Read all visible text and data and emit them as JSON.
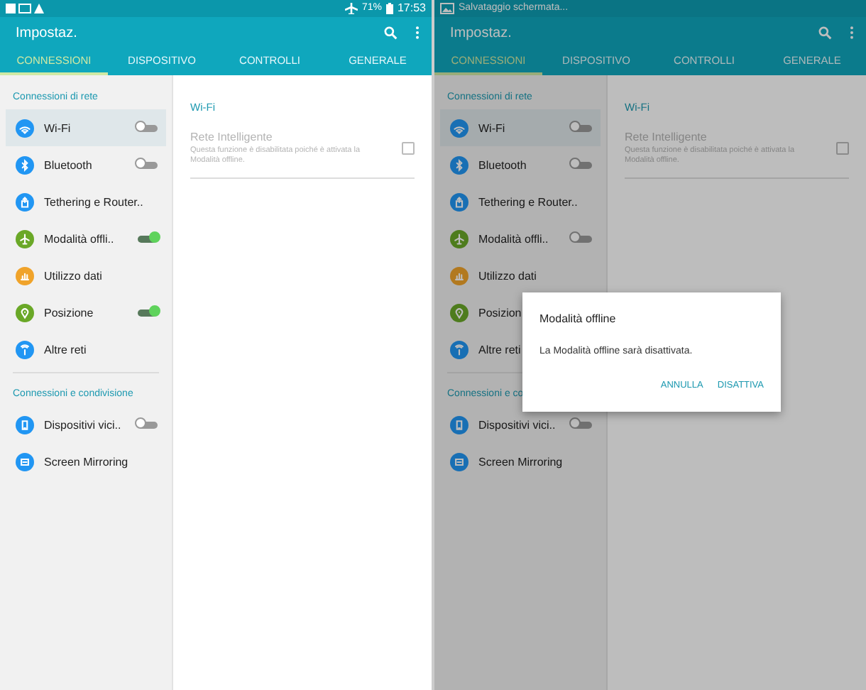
{
  "screens": [
    {
      "status_bar": {
        "battery": "71%",
        "time": "17:53"
      },
      "title": "Impostaz.",
      "tabs": [
        {
          "label": "CONNESSIONI",
          "selected": true
        },
        {
          "label": "DISPOSITIVO",
          "selected": false
        },
        {
          "label": "CONTROLLI",
          "selected": false
        },
        {
          "label": "GENERALE",
          "selected": false
        }
      ],
      "sections": [
        {
          "header": "Connessioni di rete",
          "items": [
            {
              "label": "Wi-Fi",
              "color": "#2196f3",
              "selected": true,
              "on": false
            },
            {
              "label": "Bluetooth",
              "color": "#2196f3",
              "selected": false,
              "on": false
            },
            {
              "label": "Tethering e Router..",
              "color": "#2196f3",
              "selected": false
            },
            {
              "label": "Modalità offli..",
              "color": "#6aa827",
              "selected": false,
              "on": true
            },
            {
              "label": "Utilizzo dati",
              "color": "#f0a32a",
              "selected": false
            },
            {
              "label": "Posizione",
              "color": "#6aa827",
              "selected": false,
              "on": true
            },
            {
              "label": "Altre reti",
              "color": "#2196f3",
              "selected": false
            }
          ]
        },
        {
          "header": "Connessioni e condivisione",
          "items": [
            {
              "label": "Dispositivi vici..",
              "color": "#2196f3",
              "selected": false,
              "on": false
            },
            {
              "label": "Screen Mirroring",
              "color": "#2196f3",
              "selected": false
            }
          ]
        }
      ],
      "detail": {
        "header": "Wi-Fi",
        "rows": [
          {
            "title": "Rete Intelligente",
            "subtitle": "Questa funzione è disabilitata poiché è attivata la Modalità offline.",
            "checked": false,
            "disabled": true
          }
        ]
      }
    },
    {
      "status_bar": {
        "notification": "Salvataggio schermata..."
      },
      "title": "Impostaz.",
      "tabs": [
        {
          "label": "CONNESSIONI",
          "selected": true
        },
        {
          "label": "DISPOSITIVO",
          "selected": false
        },
        {
          "label": "CONTROLLI",
          "selected": false
        },
        {
          "label": "GENERALE",
          "selected": false
        }
      ],
      "sections": [
        {
          "header": "Connessioni di rete",
          "items": [
            {
              "label": "Wi-Fi",
              "color": "#186fb4",
              "selected": true,
              "on": false
            },
            {
              "label": "Bluetooth",
              "color": "#186fb4",
              "selected": false,
              "on": false
            },
            {
              "label": "Tethering e Router..",
              "color": "#186fb4",
              "selected": false
            },
            {
              "label": "Modalità offli..",
              "color": "#4e7c1d",
              "selected": false,
              "on": false
            },
            {
              "label": "Utilizzo dati",
              "color": "#b2791f",
              "selected": false
            },
            {
              "label": "Posizion",
              "color": "#4e7c1d",
              "selected": false
            },
            {
              "label": "Altre reti",
              "color": "#186fb4",
              "selected": false
            }
          ]
        },
        {
          "header": "Connessioni e co",
          "items": [
            {
              "label": "Dispositivi vici..",
              "color": "#186fb4",
              "selected": false,
              "on": false
            },
            {
              "label": "Screen Mirroring",
              "color": "#186fb4",
              "selected": false
            }
          ]
        }
      ],
      "detail": {
        "header": "Wi-Fi",
        "rows": [
          {
            "title": "Rete Intelligente",
            "subtitle": "Questa funzione è disabilitata poiché è attivata la Modalità offline.",
            "checked": false,
            "disabled": true
          }
        ]
      },
      "dialog": {
        "title": "Modalità offline",
        "message": "La Modalità offline sarà disattivata.",
        "buttons": [
          "ANNULLA",
          "DISATTIVA"
        ]
      }
    }
  ]
}
